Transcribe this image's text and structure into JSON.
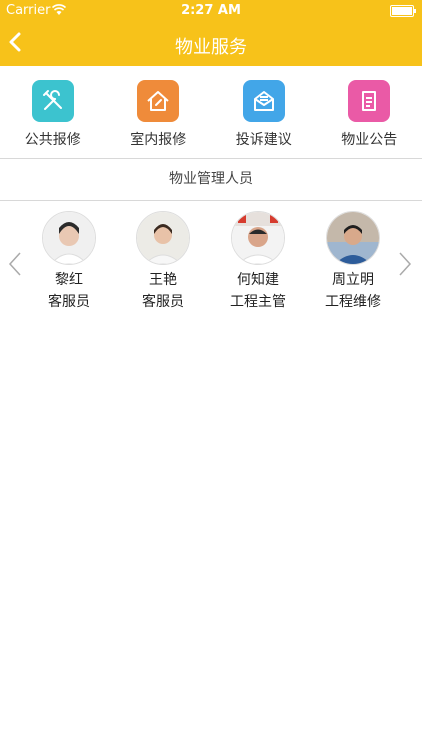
{
  "status_bar": {
    "carrier": "Carrier",
    "time": "2:27 AM"
  },
  "nav": {
    "title": "物业服务"
  },
  "services": [
    {
      "label": "公共报修",
      "icon": "tools-icon",
      "color": "#3cc3cf"
    },
    {
      "label": "室内报修",
      "icon": "house-repair-icon",
      "color": "#ef8b3a"
    },
    {
      "label": "投诉建议",
      "icon": "mail-icon",
      "color": "#42a6e8"
    },
    {
      "label": "物业公告",
      "icon": "notice-icon",
      "color": "#ea5aa6"
    }
  ],
  "management": {
    "title": "物业管理人员",
    "staff": [
      {
        "name": "黎红",
        "role": "客服员"
      },
      {
        "name": "王艳",
        "role": "客服员"
      },
      {
        "name": "何知建",
        "role": "工程主管"
      },
      {
        "name": "周立明",
        "role": "工程维修"
      }
    ]
  },
  "colors": {
    "accent": "#f7c21a",
    "divider": "#d8d8d8"
  }
}
